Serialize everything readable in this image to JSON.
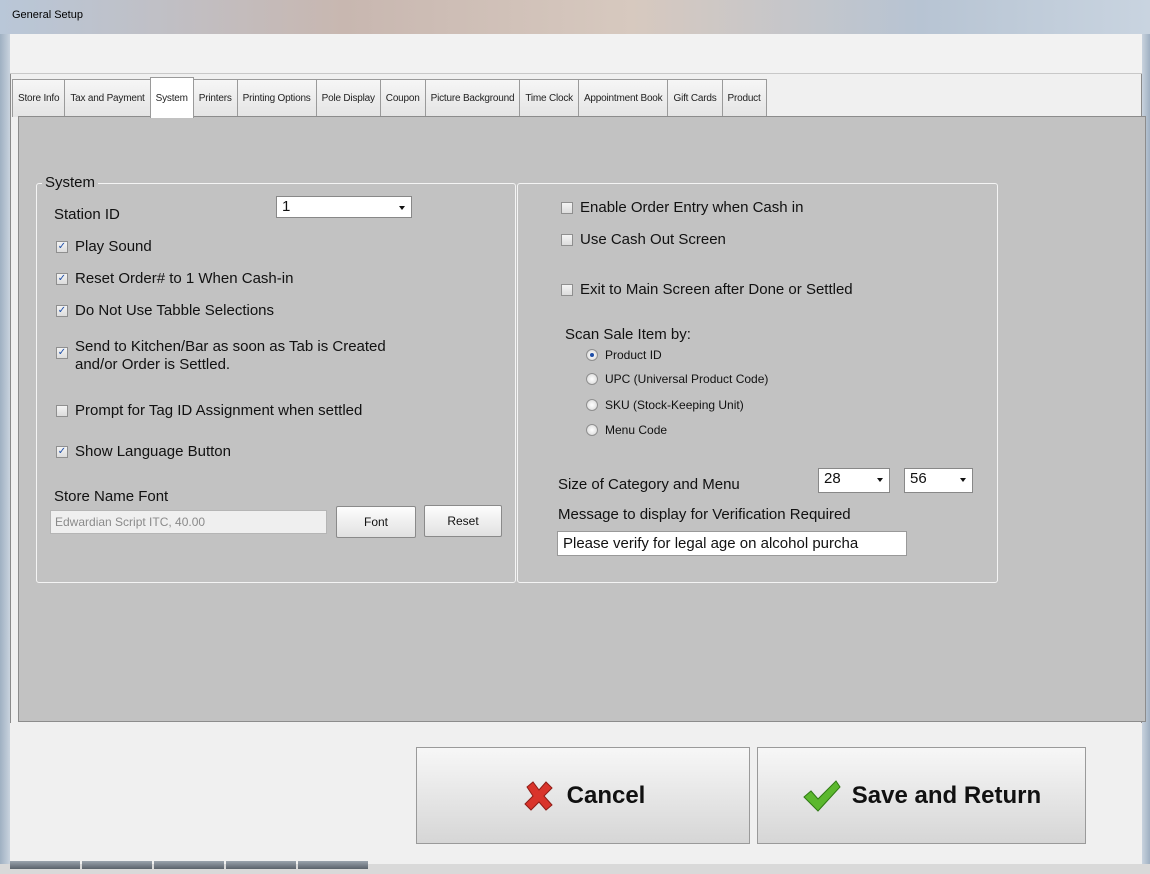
{
  "window": {
    "title": "General Setup"
  },
  "tabs": [
    {
      "label": "Store Info"
    },
    {
      "label": "Tax and Payment"
    },
    {
      "label": "System",
      "active": true
    },
    {
      "label": "Printers"
    },
    {
      "label": "Printing Options"
    },
    {
      "label": "Pole Display"
    },
    {
      "label": "Coupon"
    },
    {
      "label": "Picture Background"
    },
    {
      "label": "Time Clock"
    },
    {
      "label": "Appointment Book"
    },
    {
      "label": "Gift Cards"
    },
    {
      "label": "Product"
    }
  ],
  "system": {
    "legend": "System",
    "station_id_label": "Station ID",
    "station_id_value": "1",
    "play_sound": {
      "label": "Play Sound",
      "checked": true
    },
    "reset_order": {
      "label": "Reset Order# to 1 When Cash-in",
      "checked": true
    },
    "no_table": {
      "label": "Do Not Use Tabble Selections",
      "checked": true
    },
    "send_kitchen": {
      "label_line1": "Send to Kitchen/Bar as soon as Tab is Created",
      "label_line2": "and/or Order is Settled.",
      "checked": true
    },
    "prompt_tag": {
      "label": "Prompt for Tag ID Assignment when settled",
      "checked": false
    },
    "show_language": {
      "label": "Show Language Button",
      "checked": true
    },
    "store_name_font_label": "Store Name Font",
    "store_name_font_value": "Edwardian Script ITC, 40.00",
    "font_button": "Font",
    "reset_button": "Reset"
  },
  "right": {
    "enable_order_entry": {
      "label": "Enable Order Entry when Cash in",
      "checked": false
    },
    "use_cash_out": {
      "label": "Use Cash Out Screen",
      "checked": false
    },
    "exit_main": {
      "label": "Exit to Main Screen after Done or Settled",
      "checked": false
    },
    "scan_label": "Scan Sale Item by:",
    "scan_options": [
      {
        "label": "Product ID",
        "selected": true
      },
      {
        "label": "UPC (Universal Product Code)",
        "selected": false
      },
      {
        "label": "SKU (Stock-Keeping Unit)",
        "selected": false
      },
      {
        "label": "Menu Code",
        "selected": false
      }
    ],
    "size_label": "Size of Category and Menu",
    "size_category": "28",
    "size_menu": "56",
    "verify_label": "Message to display for Verification Required",
    "verify_value": "Please verify for legal age on alcohol purcha"
  },
  "buttons": {
    "cancel": "Cancel",
    "save": "Save and Return"
  },
  "colors": {
    "tab_page": "#c2c2c2",
    "check_mark": "#1e4ea8",
    "cancel_icon": "#d9342b",
    "save_icon": "#5cb82e"
  }
}
